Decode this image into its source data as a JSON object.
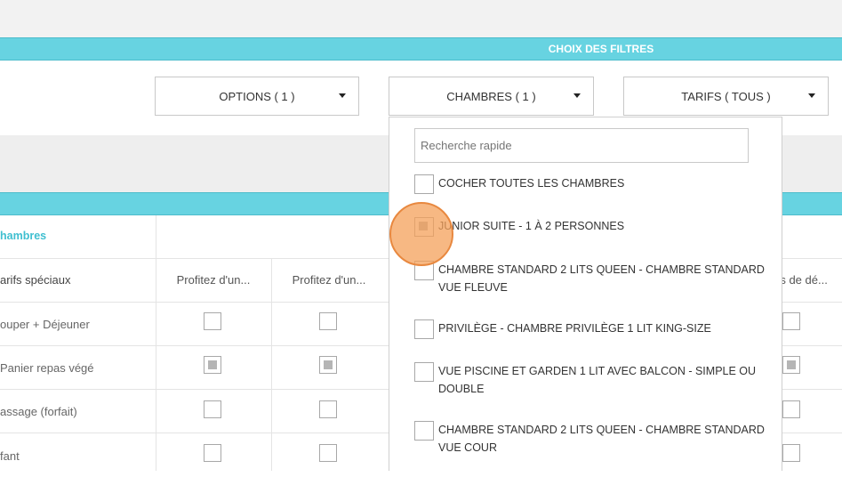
{
  "header": {
    "filter_title": "CHOIX DES FILTRES"
  },
  "filters": {
    "options_label": "OPTIONS ( 1 )",
    "chambres_label": "CHAMBRES ( 1 )",
    "tarifs_label": "TARIFS ( TOUS )"
  },
  "table": {
    "header_label": "hambres",
    "columns": [
      "Profitez d'un...",
      "Profitez d'un...",
      "rs de dé..."
    ],
    "rows": [
      {
        "label": "arifs spéciaux"
      },
      {
        "label": "ouper + Déjeuner",
        "checks": [
          false,
          false,
          false
        ]
      },
      {
        "label": "Panier repas végé",
        "checks": [
          true,
          true,
          true
        ]
      },
      {
        "label": "assage (forfait)",
        "checks": [
          false,
          false,
          false
        ]
      },
      {
        "label": "fant",
        "checks": [
          false,
          false,
          false
        ]
      }
    ]
  },
  "dropdown_panel": {
    "search_placeholder": "Recherche rapide",
    "items": [
      {
        "label": "COCHER TOUTES LES CHAMBRES",
        "checked": false
      },
      {
        "label": "JUNIOR SUITE - 1 À 2 PERSONNES",
        "checked": true
      },
      {
        "label": "CHAMBRE STANDARD 2 LITS QUEEN - CHAMBRE STANDARD VUE FLEUVE",
        "checked": false
      },
      {
        "label": "PRIVILÈGE - CHAMBRE PRIVILÈGE 1 LIT KING-SIZE",
        "checked": false
      },
      {
        "label": "VUE PISCINE ET GARDEN 1 LIT AVEC BALCON - SIMPLE OU DOUBLE",
        "checked": false
      },
      {
        "label": "CHAMBRE STANDARD 2 LITS QUEEN - CHAMBRE STANDARD VUE COUR",
        "checked": false
      }
    ]
  },
  "colors": {
    "accent_teal": "#67d3e1",
    "cursor_orange": "#f4a05a"
  }
}
